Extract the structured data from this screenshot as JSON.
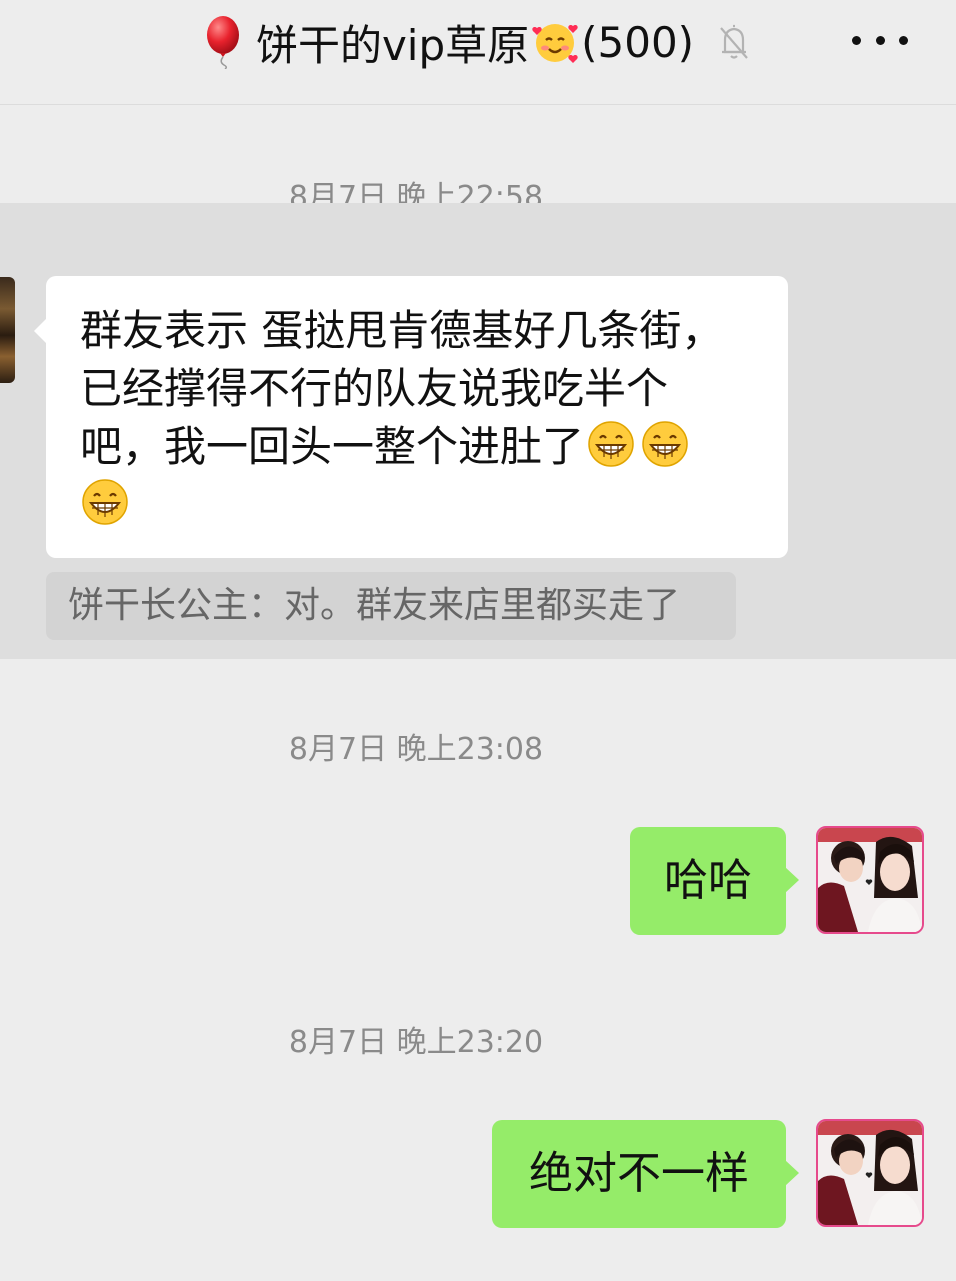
{
  "header": {
    "title": "饼干的vip草原",
    "member_count": "(500)",
    "title_leading_icon": "red-balloon-icon",
    "title_emoji_icon": "smiling-face-with-hearts-icon",
    "mute_icon": "bell-off-icon",
    "more_icon": "more-dots-icon"
  },
  "messages": [
    {
      "time": "8月7日 晚上22:58",
      "direction": "incoming",
      "lines": [
        "群友表示 蛋挞甩肯德基好几条街，",
        "已经撑得不行的队友说我吃半个",
        "吧，我一回头一整个进肚了"
      ],
      "emoji_count": 3,
      "emoji": "grinning-face-icon",
      "quote": "饼干长公主：对。群友来店里都买走了"
    },
    {
      "time": "8月7日 晚上23:08",
      "direction": "outgoing",
      "text": "哈哈"
    },
    {
      "time": "8月7日 晚上23:20",
      "direction": "outgoing",
      "text": "绝对不一样"
    }
  ],
  "colors": {
    "background": "#ededed",
    "highlight": "#dedede",
    "outgoing_bubble": "#95ec69",
    "incoming_bubble": "#ffffff",
    "quote_bg": "#d3d3d3",
    "avatar_border": "#e64a8c"
  }
}
